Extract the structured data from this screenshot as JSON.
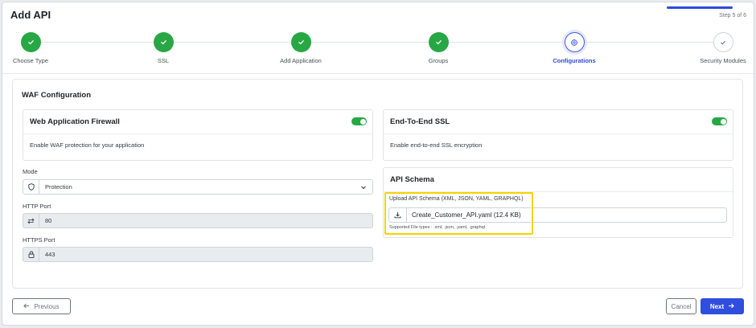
{
  "header": {
    "title": "Add API",
    "step_indicator": "Step 5 of 6",
    "progress": 0.83
  },
  "steps": [
    {
      "label": "Choose Type",
      "state": "done"
    },
    {
      "label": "SSL",
      "state": "done"
    },
    {
      "label": "Add Application",
      "state": "done"
    },
    {
      "label": "Groups",
      "state": "done"
    },
    {
      "label": "Configurations",
      "state": "active"
    },
    {
      "label": "Security Modules",
      "state": "pending"
    }
  ],
  "section": {
    "title": "WAF Configuration"
  },
  "waf_card": {
    "title": "Web Application Firewall",
    "description": "Enable WAF protection for your application",
    "enabled": true
  },
  "ssl_card": {
    "title": "End-To-End SSL",
    "description": "Enable end-to-end SSL encryption",
    "enabled": true
  },
  "mode": {
    "label": "Mode",
    "value": "Protection"
  },
  "http_port": {
    "label": "HTTP Port",
    "value": "80"
  },
  "https_port": {
    "label": "HTTPS Port",
    "value": "443"
  },
  "schema": {
    "title": "API Schema",
    "upload_label": "Upload API Schema (XML, JSON, YAML, GRAPHQL)",
    "file_name": "Create_Customer_API.yaml (12.4 KB)",
    "hint": "Supported File types : .xml, .json, .yaml, .graphql"
  },
  "buttons": {
    "previous": "Previous",
    "cancel": "Cancel",
    "next": "Next"
  },
  "colors": {
    "primary": "#2f4edd",
    "success": "#28a745",
    "highlight": "#f5d400"
  }
}
